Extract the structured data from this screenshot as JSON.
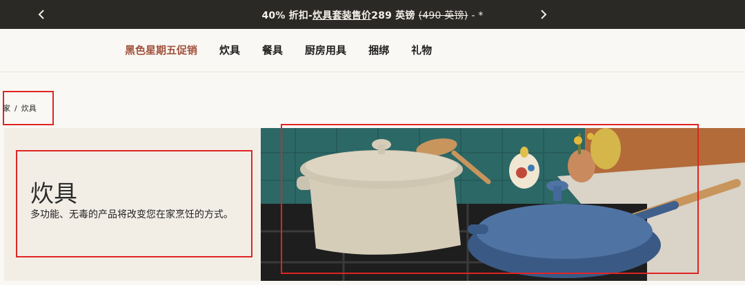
{
  "announcement": {
    "discount": "40% 折扣",
    "separator": "-",
    "link_text": "炊具套装售价",
    "price": "289 英镑",
    "original_price": "(490 英镑)",
    "suffix": "- *"
  },
  "nav": {
    "items": [
      "黑色星期五促销",
      "炊具",
      "餐具",
      "厨房用具",
      "捆绑",
      "礼物"
    ]
  },
  "breadcrumb": {
    "home": "家",
    "separator": "/",
    "current": "炊具"
  },
  "hero": {
    "title": "炊具",
    "description": "多功能、无毒的产品将改变您在家烹饪的方式。"
  },
  "colors": {
    "announcement_bg": "#2b2926",
    "page_bg": "#faf8f4",
    "promo": "#a0513b",
    "highlight_border": "#e02323"
  },
  "icons": {
    "prev": "chevron-left-icon",
    "next": "chevron-right-icon"
  }
}
